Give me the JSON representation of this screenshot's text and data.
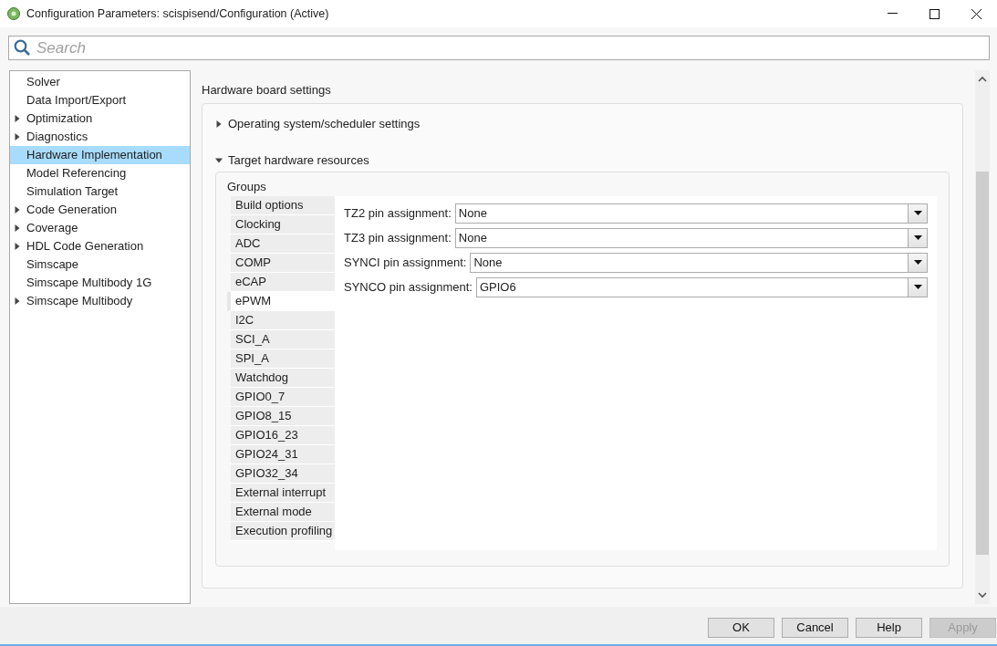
{
  "window": {
    "title": "Configuration Parameters: scispisend/Configuration (Active)"
  },
  "search": {
    "placeholder": "Search"
  },
  "sidebar": {
    "items": [
      {
        "label": "Solver",
        "expandable": false,
        "selected": false
      },
      {
        "label": "Data Import/Export",
        "expandable": false,
        "selected": false
      },
      {
        "label": "Optimization",
        "expandable": true,
        "selected": false
      },
      {
        "label": "Diagnostics",
        "expandable": true,
        "selected": false
      },
      {
        "label": "Hardware Implementation",
        "expandable": false,
        "selected": true
      },
      {
        "label": "Model Referencing",
        "expandable": false,
        "selected": false
      },
      {
        "label": "Simulation Target",
        "expandable": false,
        "selected": false
      },
      {
        "label": "Code Generation",
        "expandable": true,
        "selected": false
      },
      {
        "label": "Coverage",
        "expandable": true,
        "selected": false
      },
      {
        "label": "HDL Code Generation",
        "expandable": true,
        "selected": false
      },
      {
        "label": "Simscape",
        "expandable": false,
        "selected": false
      },
      {
        "label": "Simscape Multibody 1G",
        "expandable": false,
        "selected": false
      },
      {
        "label": "Simscape Multibody",
        "expandable": true,
        "selected": false
      }
    ]
  },
  "panel": {
    "heading": "Hardware board settings",
    "sections": [
      {
        "title": "Operating system/scheduler settings",
        "expanded": false
      },
      {
        "title": "Target hardware resources",
        "expanded": true
      }
    ],
    "groups_label": "Groups",
    "groups": [
      {
        "label": "Build options",
        "selected": false
      },
      {
        "label": "Clocking",
        "selected": false
      },
      {
        "label": "ADC",
        "selected": false
      },
      {
        "label": "COMP",
        "selected": false
      },
      {
        "label": "eCAP",
        "selected": false
      },
      {
        "label": "ePWM",
        "selected": true
      },
      {
        "label": "I2C",
        "selected": false
      },
      {
        "label": "SCI_A",
        "selected": false
      },
      {
        "label": "SPI_A",
        "selected": false
      },
      {
        "label": "Watchdog",
        "selected": false
      },
      {
        "label": "GPIO0_7",
        "selected": false
      },
      {
        "label": "GPIO8_15",
        "selected": false
      },
      {
        "label": "GPIO16_23",
        "selected": false
      },
      {
        "label": "GPIO24_31",
        "selected": false
      },
      {
        "label": "GPIO32_34",
        "selected": false
      },
      {
        "label": "External interrupt",
        "selected": false
      },
      {
        "label": "External mode",
        "selected": false
      },
      {
        "label": "Execution profiling",
        "selected": false
      }
    ],
    "fields": [
      {
        "label": "TZ2 pin assignment:",
        "value": "None"
      },
      {
        "label": "TZ3 pin assignment:",
        "value": "None"
      },
      {
        "label": "SYNCI pin assignment:",
        "value": "None"
      },
      {
        "label": "SYNCO pin assignment:",
        "value": "GPIO6"
      }
    ]
  },
  "buttons": [
    {
      "label": "OK",
      "disabled": false
    },
    {
      "label": "Cancel",
      "disabled": false
    },
    {
      "label": "Help",
      "disabled": false
    },
    {
      "label": "Apply",
      "disabled": true
    }
  ]
}
